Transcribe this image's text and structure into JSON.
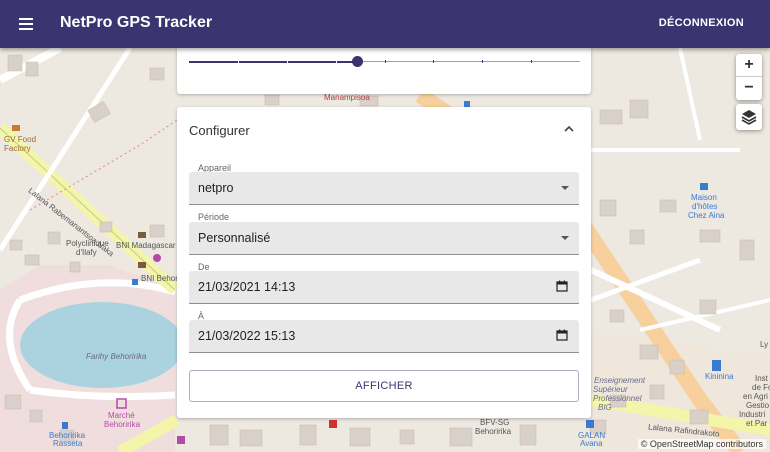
{
  "app": {
    "title": "NetPro GPS Tracker",
    "logout_label": "DÉCONNEXION",
    "menu_icon": "menu-icon"
  },
  "map": {
    "zoom_in_label": "+",
    "zoom_out_label": "−",
    "layers_icon": "layers-icon",
    "attribution": "© OpenStreetMap contributors",
    "labels": {
      "manampisoa": "Manampisoa",
      "gv_food_1": "GV Food",
      "gv_food_2": "Factory",
      "lalana_north": "Lalana Rabemanantsoa Naka",
      "polyclinique_1": "Polyclinique",
      "polyclinique_2": "d'Ilafy",
      "bni_madagascar": "BNI Madagascar",
      "bni_behori": "BNI Behori",
      "farihy": "Farihy Behoririka",
      "marche_1": "Marché",
      "marche_2": "Behoririka",
      "behoririka_rasseta_1": "Behoririka",
      "behoririka_rasseta_2": "Rasseta",
      "maison_1": "Maison",
      "maison_2": "d'hôtes",
      "maison_3": "Chez Aina",
      "kininina": "Kininina",
      "institut_1": "Inst",
      "institut_2": "de For",
      "institut_3": "en Agri",
      "institut_4": "Gestio",
      "institut_5": "Industri",
      "institut_6": "et Par",
      "superieur_1": "Enseignement",
      "superieur_2": "Supérieur",
      "superieur_3": "Professionnel",
      "superieur_4": "BIG",
      "lalana_south": "Lalana Rafindrakoto",
      "galan_1": "GALAN",
      "galan_2": "Avana",
      "bfv_1": "BFV-SG",
      "bfv_2": "Behoririka",
      "ly": "Ly"
    }
  },
  "slider": {
    "value_fraction": 0.43,
    "ticks": 7
  },
  "config": {
    "title": "Configurer",
    "device": {
      "label": "Appareil",
      "value": "netpro"
    },
    "period": {
      "label": "Période",
      "value": "Personnalisé"
    },
    "from": {
      "label": "De",
      "value": "21/03/2021 14:13"
    },
    "to": {
      "label": "À",
      "value": "21/03/2022 15:13"
    },
    "submit_label": "AFFICHER"
  },
  "colors": {
    "appbar": "#3a3570",
    "accent": "#3a3570",
    "road_major": "#f7d09e",
    "road_green": "#f3f5a9",
    "water": "#aad3df"
  }
}
